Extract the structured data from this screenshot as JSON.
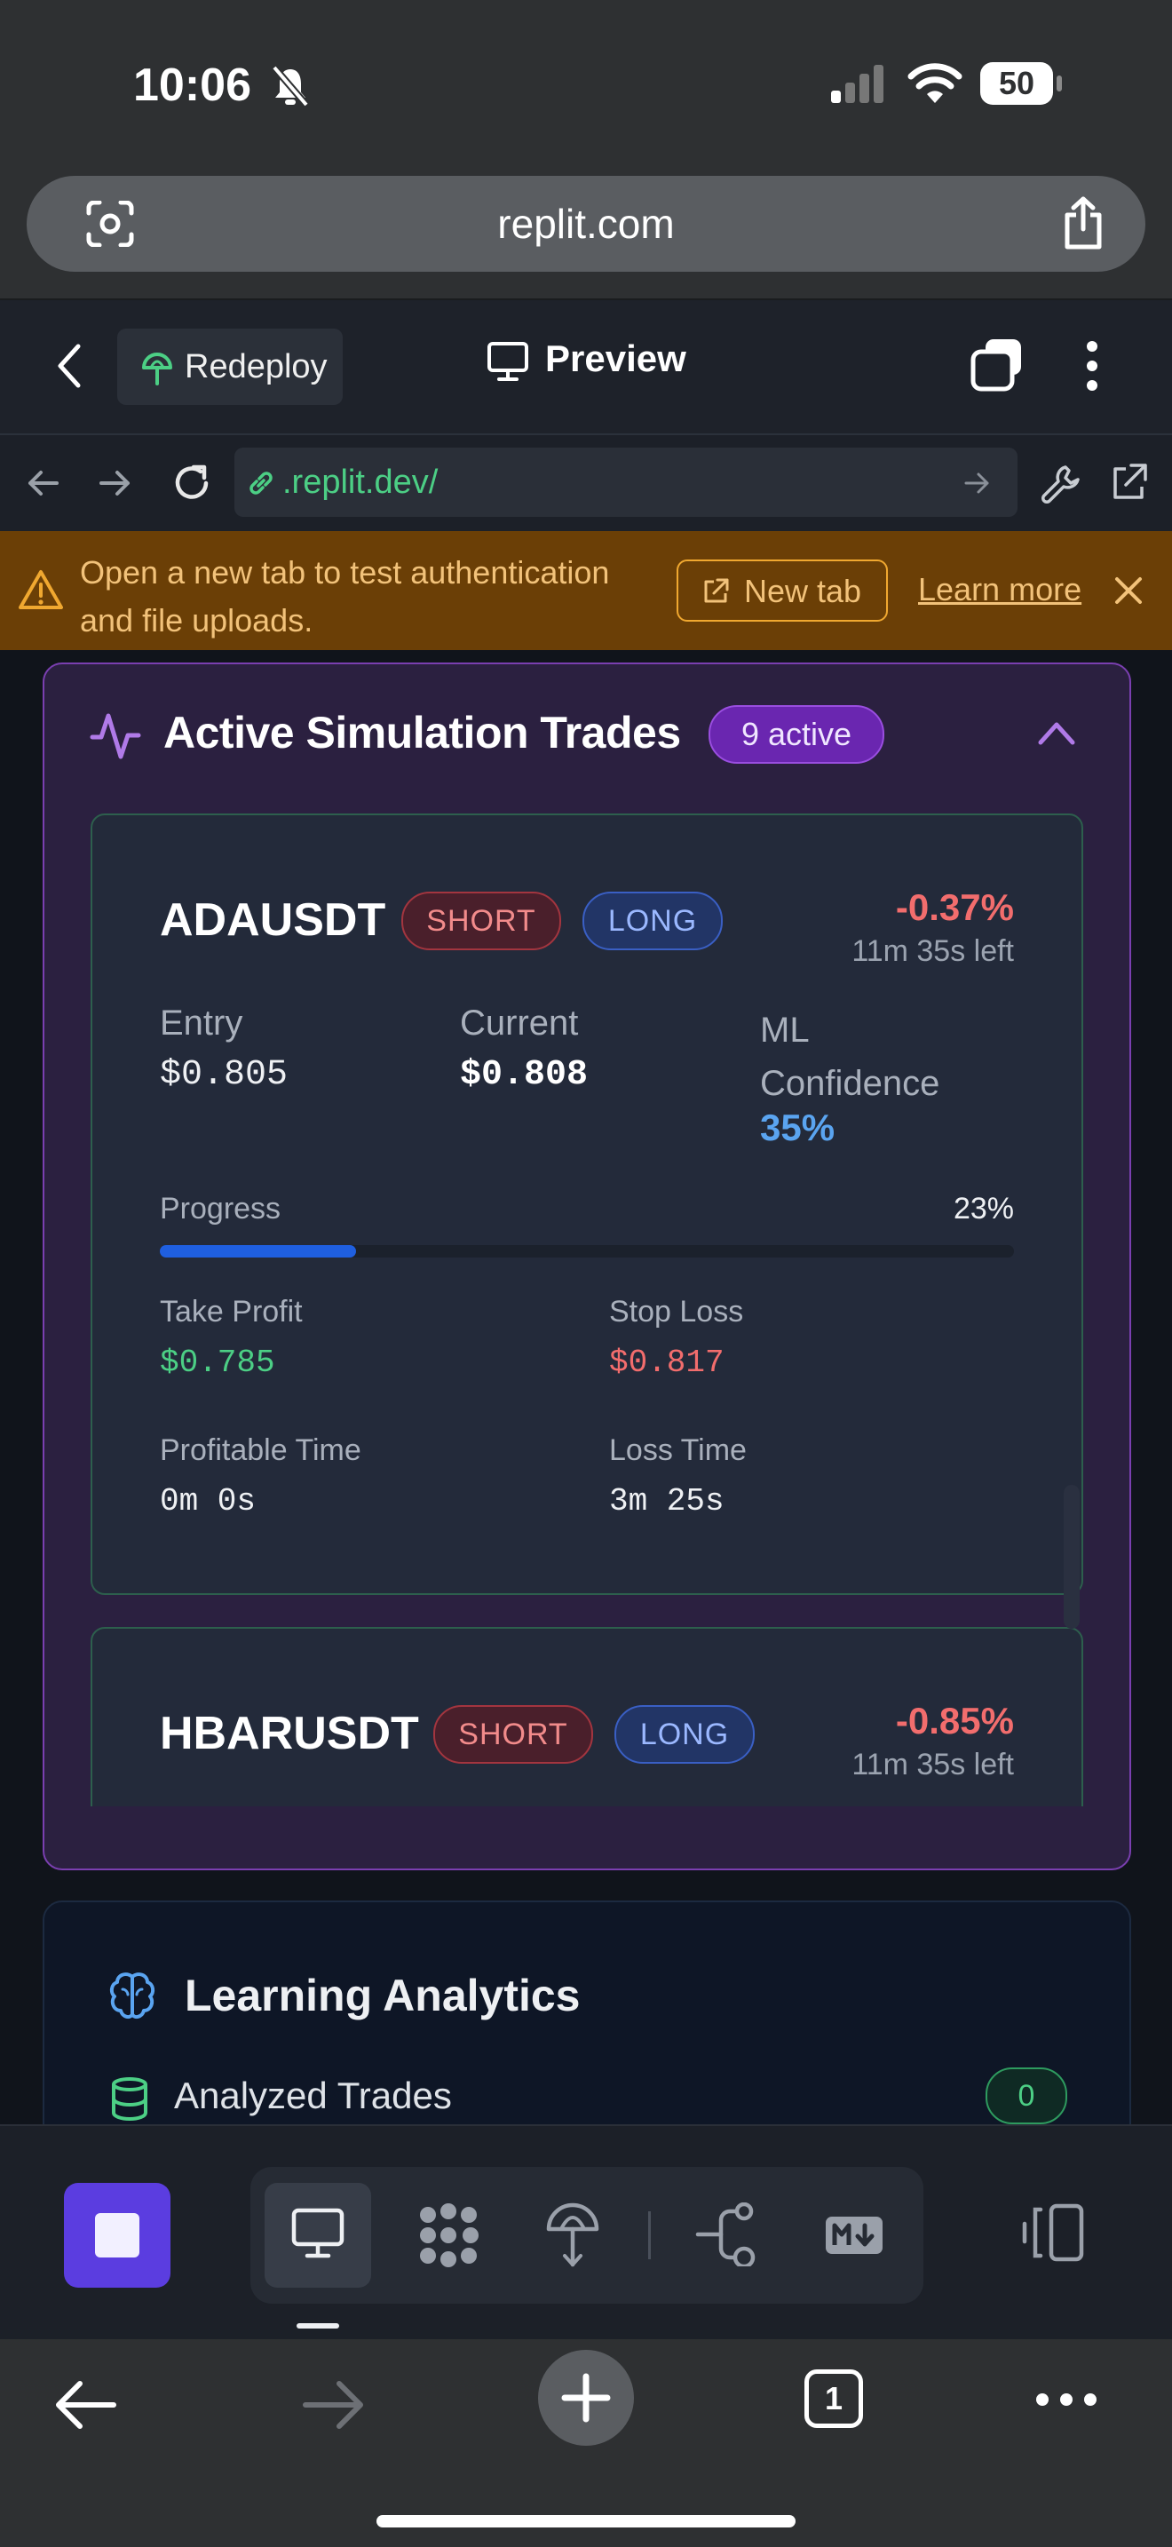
{
  "status": {
    "time": "10:06",
    "battery": "50"
  },
  "browser": {
    "domain": "replit.com"
  },
  "replit": {
    "redeploy_label": "Redeploy",
    "preview_label": "Preview"
  },
  "nav": {
    "url_text": ".replit.dev/"
  },
  "banner": {
    "line1": "Open a new tab to test authentication",
    "line2": "and file uploads.",
    "new_tab_label": "New tab",
    "learn_more_label": "Learn more"
  },
  "simulation": {
    "title": "Active Simulation Trades",
    "active_badge": "9 active",
    "trades": [
      {
        "symbol": "ADAUSDT",
        "short_label": "SHORT",
        "long_label": "LONG",
        "pnl": "-0.37%",
        "time_left": "11m 35s left",
        "entry_label": "Entry",
        "entry_value": "$0.805",
        "current_label": "Current",
        "current_value": "$0.808",
        "ml_label_line1": "ML",
        "ml_label_line2": "Confidence",
        "ml_value": "35%",
        "progress_label": "Progress",
        "progress_value": "23%",
        "progress_fraction": 0.23,
        "take_profit_label": "Take Profit",
        "take_profit_value": "$0.785",
        "stop_loss_label": "Stop Loss",
        "stop_loss_value": "$0.817",
        "profitable_time_label": "Profitable Time",
        "profitable_time_value": "0m 0s",
        "loss_time_label": "Loss Time",
        "loss_time_value": "3m 25s"
      },
      {
        "symbol": "HBARUSDT",
        "short_label": "SHORT",
        "long_label": "LONG",
        "pnl": "-0.85%",
        "time_left": "11m 35s left"
      }
    ]
  },
  "learning": {
    "title": "Learning Analytics",
    "analyzed_trades_label": "Analyzed Trades",
    "analyzed_trades_count": "0"
  },
  "safari_bottom": {
    "tab_count": "1"
  },
  "colors": {
    "accent_purple": "#7a3fb0",
    "negative_red": "#f26d6d",
    "positive_green": "#4ccf85",
    "ml_blue": "#5aa4f0",
    "progress_blue": "#1f5fe0",
    "banner_bg": "#6b3f06"
  }
}
